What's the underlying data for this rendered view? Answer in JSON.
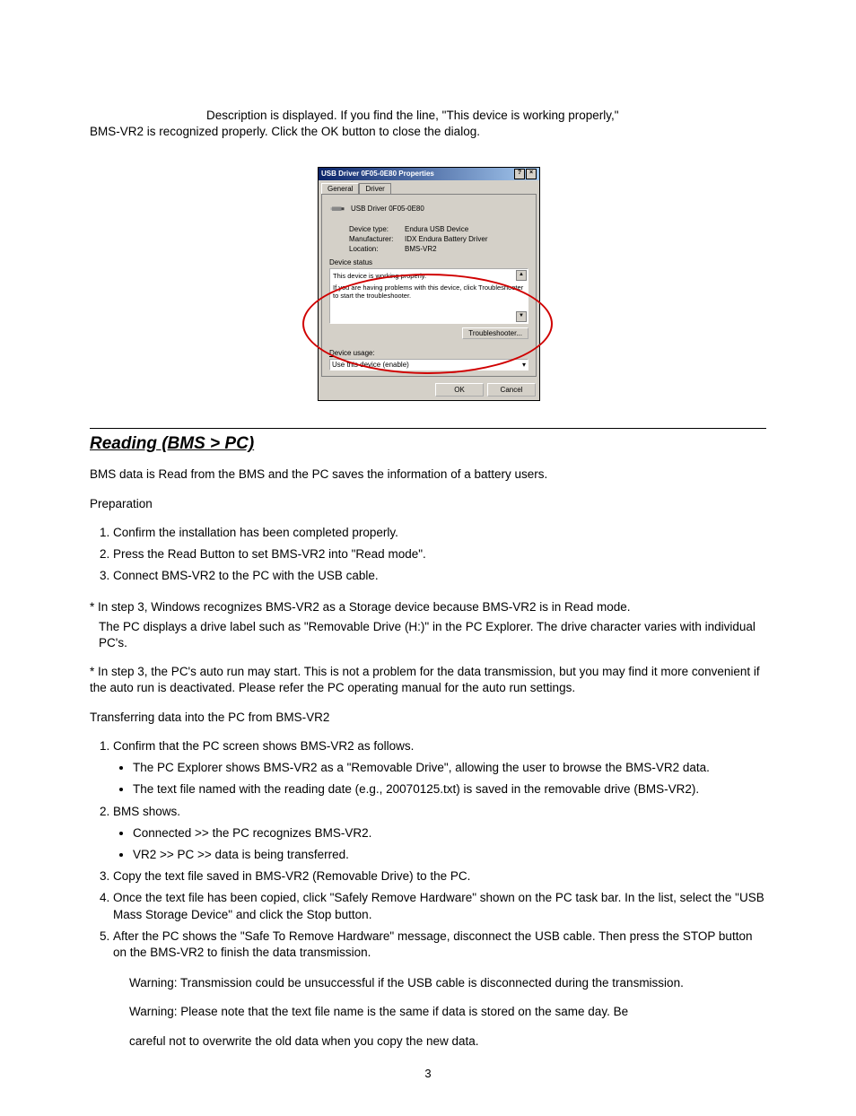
{
  "intro": {
    "line1": "Description is displayed",
    "line1_tail": ". If you find the line, \"This device is working properly,\"",
    "line2": "BMS-VR2 is recognized properly.  Click the OK button to close the dialog."
  },
  "dialog": {
    "title": "USB Driver 0F05-0E80 Properties",
    "help": "?",
    "close": "×",
    "tabs": {
      "general": "General",
      "driver": "Driver"
    },
    "device_name": "USB Driver 0F05-0E80",
    "props": {
      "type_label": "Device type:",
      "type_value": "Endura USB Device",
      "mfr_label": "Manufacturer:",
      "mfr_value": "IDX Endura Battery Driver",
      "loc_label": "Location:",
      "loc_value": "BMS-VR2"
    },
    "status_label": "Device status",
    "status_line1": "This device is working properly.",
    "status_line2": "If you are having problems with this device, click Troubleshooter to start the troubleshooter.",
    "troubleshooter": "Troubleshooter...",
    "usage_label": "Device usage:",
    "usage_value": "Use this device (enable)",
    "ok": "OK",
    "cancel": "Cancel"
  },
  "section_heading": "Reading (BMS > PC)",
  "section": {
    "p1": "BMS data is Read from the BMS and the PC saves the information of a battery users.",
    "p2": "Preparation",
    "ol": [
      "Confirm the installation has been completed properly.",
      "Press the Read Button to set BMS-VR2 into \"Read mode\".",
      "Connect BMS-VR2 to the PC with the USB cable."
    ],
    "note1a": "* In step 3, Windows recognizes BMS-VR2 as a Storage device because BMS-VR2 is in Read mode.",
    "note1b": "The PC displays a drive label such as \"Removable Drive (H:)\" in the PC Explorer. The drive character varies with individual PC's.",
    "note2": "* In step 3, the PC's auto run may start.  This is not a problem for the data transmission, but you may find it more convenient if the auto run is deactivated.  Please refer the PC operating manual for the auto run settings.",
    "p3": "Transferring data into the PC from BMS-VR2",
    "ol2": [
      "Confirm that the PC screen shows BMS-VR2 as follows.",
      "BMS shows.",
      "Copy the text file saved in BMS-VR2 (Removable Drive) to the PC.",
      "Once the text file has been copied, click \"Safely Remove Hardware\" shown on the PC task bar.  In the list, select the \"USB Mass Storage Device\" and click the Stop button.",
      "After the PC shows the \"Safe To Remove Hardware\" message, disconnect the USB cable.  Then press the STOP button on the BMS-VR2 to finish the data transmission."
    ],
    "nested": [
      "The PC Explorer shows BMS-VR2 as a \"Removable Drive\", allowing the user to browse the BMS-VR2 data.",
      "The text file named with the reading date (e.g., 20070125.txt) is saved in the removable drive (BMS-VR2)."
    ],
    "bms_items": [
      "Connected >> the PC recognizes BMS-VR2.",
      "VR2 >> PC  >> data is being transferred."
    ],
    "warn1_label": "Warning:",
    "warn1_text": "Transmission could be unsuccessful if the USB cable is disconnected during the transmission.",
    "warn2_label": "Warning:",
    "warn2_text": "Please note that the text file name is the same if data is stored on the same day. Be",
    "warn2_text2": "careful not to overwrite the old data when you copy the new data."
  },
  "page_number": "3"
}
